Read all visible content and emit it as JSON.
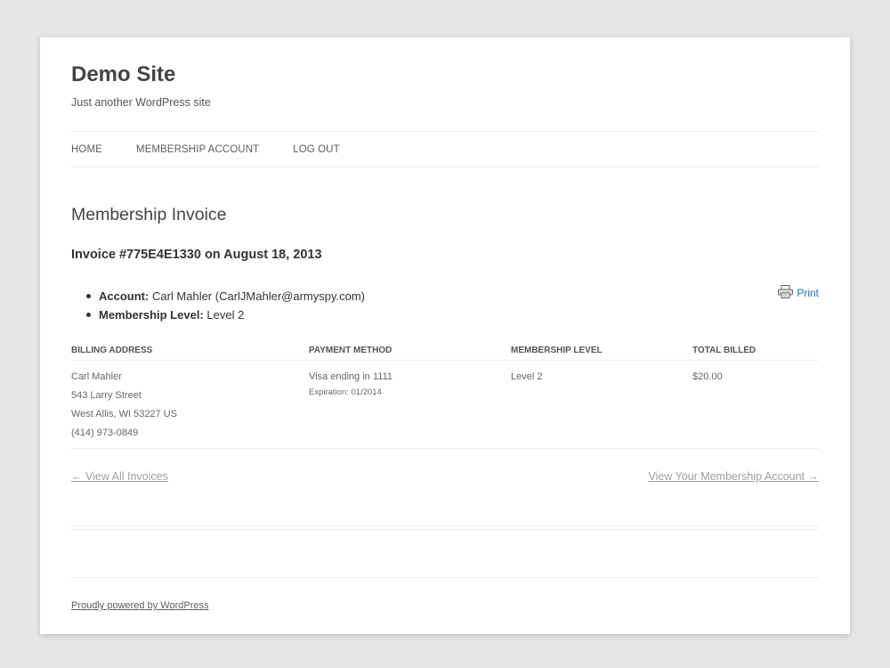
{
  "site": {
    "title": "Demo Site",
    "description": "Just another WordPress site"
  },
  "nav": {
    "items": [
      {
        "label": "HOME"
      },
      {
        "label": "MEMBERSHIP ACCOUNT"
      },
      {
        "label": "LOG OUT"
      }
    ]
  },
  "page": {
    "title": "Membership Invoice",
    "invoice_heading": "Invoice #775E4E1330 on August 18, 2013",
    "print_label": "Print",
    "print_icon": "printer-icon"
  },
  "summary": {
    "account_label": "Account:",
    "account_value": " Carl Mahler (CarlJMahler@armyspy.com)",
    "level_label": "Membership Level:",
    "level_value": " Level 2"
  },
  "table": {
    "headers": {
      "billing": "Billing Address",
      "payment": "Payment Method",
      "level": "Membership Level",
      "total": "Total Billed"
    },
    "billing_lines": [
      "Carl Mahler",
      "543 Larry Street",
      "West Allis, WI 53227 US",
      "(414) 973-0849"
    ],
    "payment": {
      "card": "Visa ending in 1111",
      "expiration": "Expiration: 01/2014"
    },
    "level": "Level 2",
    "total": "$20.00"
  },
  "links": {
    "prev": "← View All Invoices",
    "next": "View Your Membership Account →"
  },
  "footer": {
    "powered": "Proudly powered by WordPress"
  },
  "colors": {
    "background": "#e6e6e6",
    "link": "#21759b",
    "muted_link": "#9f9f9f"
  }
}
